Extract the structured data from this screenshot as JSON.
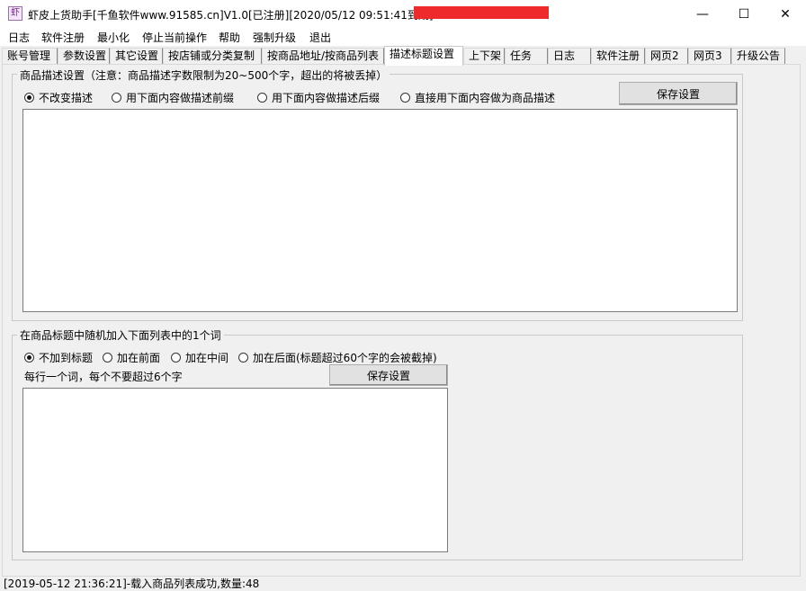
{
  "window": {
    "title": "虾皮上货助手[千鱼软件www.91585.cn]V1.0[已注册][2020/05/12 09:51:41到期]",
    "minimize_glyph": "—",
    "maximize_glyph": "☐",
    "close_glyph": "✕",
    "icon_glyph": "虾",
    "redaction_color": "#ee2a2a"
  },
  "menu": [
    "日志",
    "软件注册",
    "最小化",
    "停止当前操作",
    "帮助",
    "强制升级",
    "退出"
  ],
  "tabs": [
    "账号管理",
    "参数设置",
    "其它设置",
    "按店铺或分类复制",
    "按商品地址/按商品列表",
    "描述标题设置",
    "上下架",
    "任务",
    "日志",
    "软件注册",
    "网页2",
    "网页3",
    "升级公告"
  ],
  "active_tab": "描述标题设置",
  "desc_group": {
    "title": "商品描述设置（注意：商品描述字数限制为20~500个字，超出的将被丢掉）",
    "options": [
      "不改变描述",
      "用下面内容做描述前缀",
      "用下面内容做描述后缀",
      "直接用下面内容做为商品描述"
    ],
    "selected": "不改变描述",
    "save_label": "保存设置",
    "text": ""
  },
  "title_group": {
    "title": "在商品标题中随机加入下面列表中的1个词",
    "options": [
      "不加到标题",
      "加在前面",
      "加在中间",
      "加在后面(标题超过60个字的会被截掉)"
    ],
    "selected": "不加到标题",
    "hint": "每行一个词，每个不要超过6个字",
    "save_label": "保存设置",
    "text": ""
  },
  "status": "[2019-05-12 21:36:21]-载入商品列表成功,数量:48"
}
